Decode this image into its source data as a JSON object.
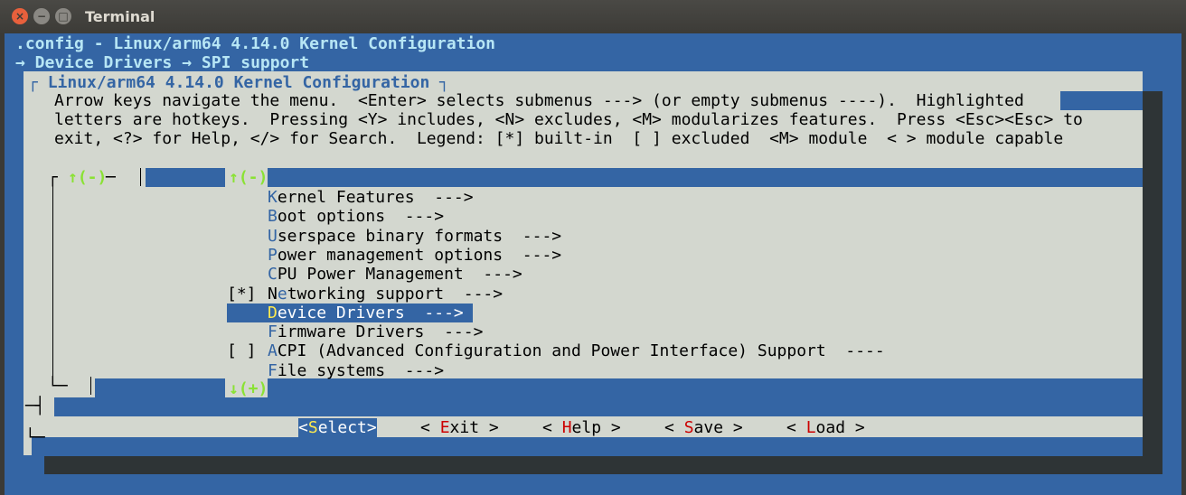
{
  "window": {
    "title": "Terminal"
  },
  "header": {
    "line1": ".config - Linux/arm64 4.14.0 Kernel Configuration",
    "line2": "→ Device Drivers → SPI support"
  },
  "dialog": {
    "title": "Linux/arm64 4.14.0 Kernel Configuration",
    "help": [
      "Arrow keys navigate the menu.  <Enter> selects submenus ---> (or empty submenus ----).  Highlighted",
      "letters are hotkeys.  Pressing <Y> includes, <N> excludes, <M> modularizes features.  Press <Esc><Esc> to",
      "exit, <?> for Help, </> for Search.  Legend: [*] built-in  [ ] excluded  <M> module  < > module capable"
    ],
    "scroll_up": "↑(-)",
    "scroll_down": "↓(+)"
  },
  "menu": {
    "items": [
      {
        "mark": "",
        "hotkey": "K",
        "rest": "ernel Features  --->",
        "selected": false
      },
      {
        "mark": "",
        "hotkey": "B",
        "rest": "oot options  --->",
        "selected": false
      },
      {
        "mark": "",
        "hotkey": "U",
        "rest": "serspace binary formats  --->",
        "selected": false
      },
      {
        "mark": "",
        "hotkey": "P",
        "rest": "ower management options  --->",
        "selected": false
      },
      {
        "mark": "",
        "hotkey": "C",
        "rest": "PU Power Management  --->",
        "selected": false
      },
      {
        "mark": "[*]",
        "hotkey": "",
        "pre": "N",
        "hotmid": "e",
        "rest": "tworking support  --->",
        "selected": false
      },
      {
        "mark": "",
        "hotkey": "D",
        "rest": "evice Drivers  --->",
        "selected": true
      },
      {
        "mark": "",
        "hotkey": "F",
        "rest": "irmware Drivers  --->",
        "selected": false
      },
      {
        "mark": "[ ]",
        "hotkey": "A",
        "rest": "CPI (Advanced Configuration and Power Interface) Support  ----",
        "selected": false
      },
      {
        "mark": "",
        "hotkey": "F",
        "rest": "ile systems  --->",
        "selected": false
      }
    ]
  },
  "buttons": [
    {
      "pre": "<",
      "hotkey": "S",
      "rest": "elect>",
      "selected": true
    },
    {
      "pre": "< ",
      "hotkey": "E",
      "rest": "xit >",
      "selected": false
    },
    {
      "pre": "< ",
      "hotkey": "H",
      "rest": "elp >",
      "selected": false
    },
    {
      "pre": "< ",
      "hotkey": "S",
      "rest": "ave >",
      "selected": false
    },
    {
      "pre": "< ",
      "hotkey": "L",
      "rest": "oad >",
      "selected": false
    }
  ],
  "colors": {
    "terminal_bg": "#3465a4",
    "dialog_bg": "#d3d7cf",
    "header_text": "#b7e6f5",
    "hotkey_selected": "#fce94f",
    "button_hotkey": "#cc0000",
    "scroll_arrow": "#8ae234"
  }
}
